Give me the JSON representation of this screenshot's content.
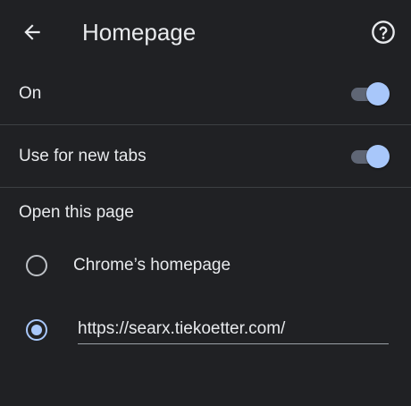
{
  "header": {
    "title": "Homepage",
    "back_icon": "arrow-left-icon",
    "help_icon": "help-circle-icon"
  },
  "settings": {
    "on": {
      "label": "On",
      "enabled": true
    },
    "new_tabs": {
      "label": "Use for new tabs",
      "enabled": true
    }
  },
  "open_page": {
    "heading": "Open this page",
    "options": [
      {
        "label": "Chrome’s homepage",
        "selected": false
      },
      {
        "value": "https://searx.tiekoetter.com/",
        "selected": true
      }
    ]
  },
  "colors": {
    "background": "#202124",
    "text": "#e8eaed",
    "accent": "#a8c7fa",
    "toggle_track": "#5f6675",
    "divider": "#3c4043"
  }
}
